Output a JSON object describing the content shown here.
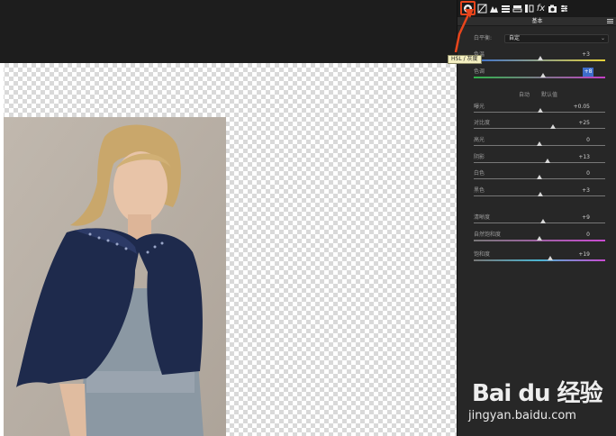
{
  "toolbar": {
    "icons": [
      "basic-panel-icon",
      "tone-curve-icon",
      "detail-icon",
      "hsl-icon",
      "split-toning-icon",
      "lens-corrections-icon",
      "effects-icon",
      "camera-calibration-icon",
      "presets-icon"
    ],
    "highlight_color": "#e8451c"
  },
  "tooltip": {
    "text": "HSL / 灰度"
  },
  "panel": {
    "title": "基本",
    "profile_label": "白平衡:",
    "profile_value": "自定",
    "wb_rows": [
      {
        "label": "色温",
        "value": "+3"
      },
      {
        "label": "色调",
        "value": "+8"
      }
    ],
    "auto_label": "自动",
    "default_label": "默认值",
    "tone_rows": [
      {
        "label": "曝光",
        "value": "+0.05"
      },
      {
        "label": "对比度",
        "value": "+25"
      },
      {
        "label": "高光",
        "value": "0"
      },
      {
        "label": "阴影",
        "value": "+13"
      },
      {
        "label": "白色",
        "value": "0"
      },
      {
        "label": "黑色",
        "value": "+3"
      }
    ],
    "presence_rows": [
      {
        "label": "清晰度",
        "value": "+9"
      },
      {
        "label": "自然饱和度",
        "value": "0"
      },
      {
        "label": "饱和度",
        "value": "+19"
      }
    ],
    "accent_color": "#3e6cc9"
  },
  "watermark": {
    "logo": "Bai du 经验",
    "url": "jingyan.baidu.com"
  }
}
